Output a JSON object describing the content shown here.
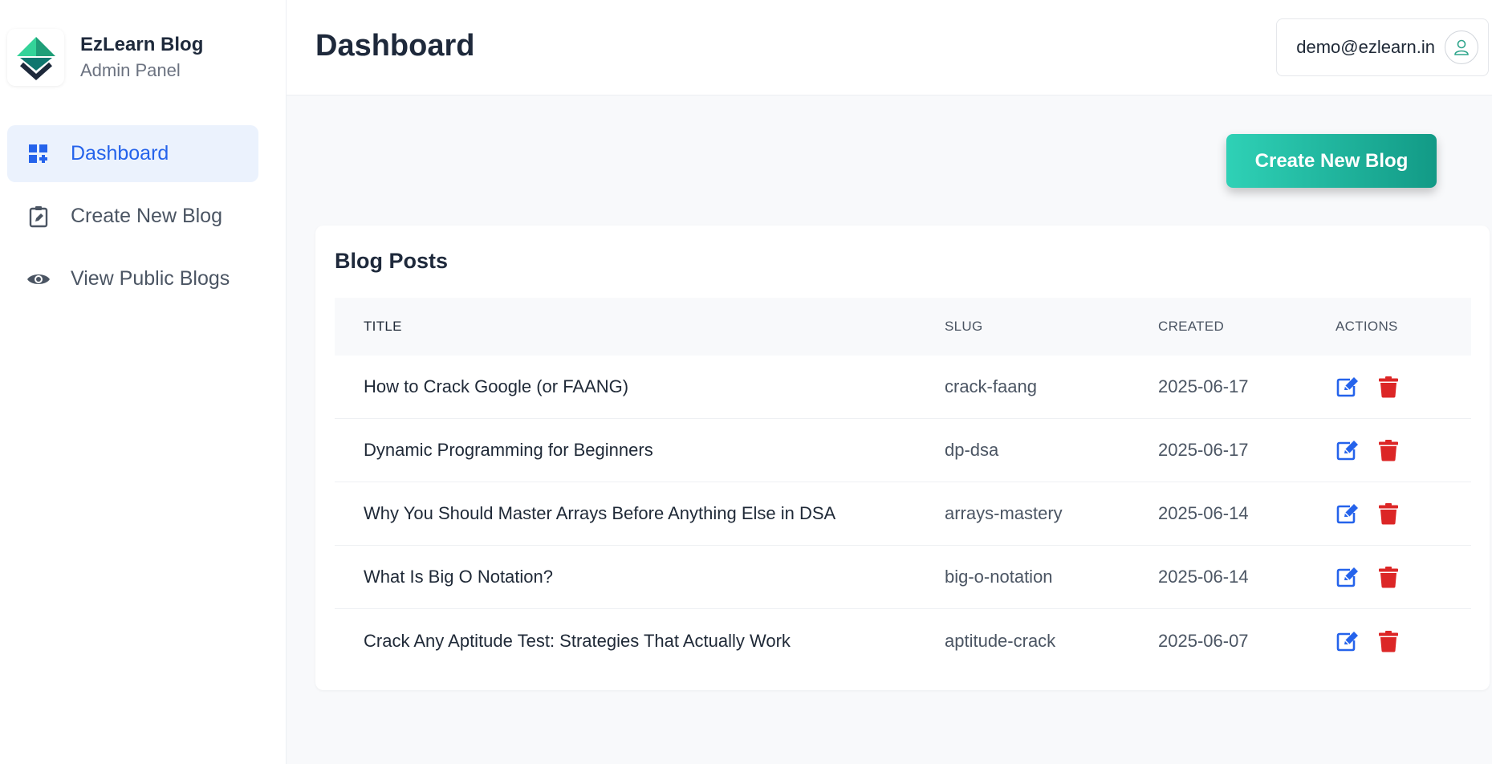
{
  "brand": {
    "title": "EzLearn Blog",
    "subtitle": "Admin Panel"
  },
  "sidebar": {
    "items": [
      {
        "label": "Dashboard",
        "icon": "dashboard-icon",
        "active": true
      },
      {
        "label": "Create New Blog",
        "icon": "clipboard-edit-icon",
        "active": false
      },
      {
        "label": "View Public Blogs",
        "icon": "eye-icon",
        "active": false
      }
    ]
  },
  "header": {
    "title": "Dashboard",
    "user_email": "demo@ezlearn.in"
  },
  "actions": {
    "create_label": "Create New Blog"
  },
  "posts": {
    "title": "Blog Posts",
    "columns": [
      "TITLE",
      "SLUG",
      "CREATED",
      "ACTIONS"
    ],
    "rows": [
      {
        "title": "How to Crack Google (or FAANG)",
        "slug": "crack-faang",
        "created": "2025-06-17"
      },
      {
        "title": "Dynamic Programming for Beginners",
        "slug": "dp-dsa",
        "created": "2025-06-17"
      },
      {
        "title": "Why You Should Master Arrays Before Anything Else in DSA",
        "slug": "arrays-mastery",
        "created": "2025-06-14"
      },
      {
        "title": "What Is Big O Notation?",
        "slug": "big-o-notation",
        "created": "2025-06-14"
      },
      {
        "title": "Crack Any Aptitude Test: Strategies That Actually Work",
        "slug": "aptitude-crack",
        "created": "2025-06-07"
      }
    ]
  },
  "colors": {
    "accent": "#2563eb",
    "active_bg": "#ebf2fd",
    "button_gradient_start": "#2fd1b6",
    "button_gradient_end": "#129a86",
    "delete": "#dc2626",
    "edit": "#2563eb"
  }
}
